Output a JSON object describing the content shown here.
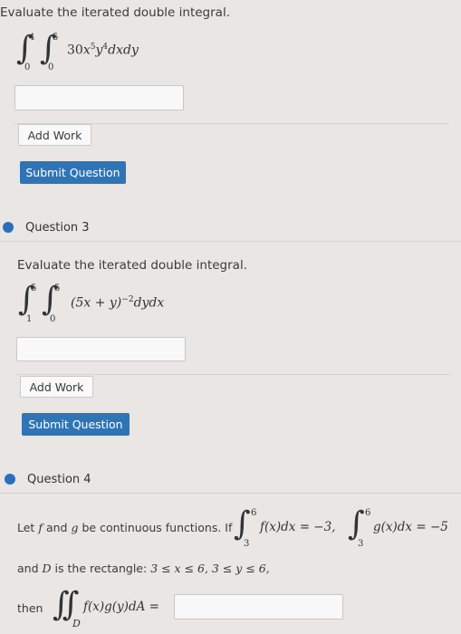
{
  "q2": {
    "prompt": "Evaluate the iterated double integral.",
    "outer": {
      "lower": "0",
      "upper": "4"
    },
    "inner": {
      "lower": "0",
      "upper": "5"
    },
    "integrand_coef": "30",
    "integrand_x": "x",
    "integrand_x_exp": "5",
    "integrand_y": "y",
    "integrand_y_exp": "4",
    "differentials": "dxdy",
    "add_work": "Add Work",
    "submit": "Submit Question"
  },
  "q3": {
    "heading": "Question 3",
    "prompt": "Evaluate the iterated double integral.",
    "outer": {
      "lower": "1",
      "upper": "5"
    },
    "inner": {
      "lower": "0",
      "upper": "5"
    },
    "integrand": "(5x + y)",
    "exponent": "−2",
    "differentials": "dydx",
    "add_work": "Add Work",
    "submit": "Submit Question"
  },
  "q4": {
    "heading": "Question 4",
    "let_text": "Let",
    "f": "f",
    "and": "and",
    "g": "g",
    "be_text": "be continuous functions. If",
    "int1_lower": "3",
    "int1_upper": "6",
    "int1_body": "f(x)dx = −3,",
    "int2_lower": "3",
    "int2_upper": "6",
    "int2_body": "g(x)dx = −5",
    "and_text": "and",
    "D": "D",
    "rect_text": "is the rectangle:",
    "rect_cond": "3 ≤ x ≤ 6, 3 ≤ y ≤ 6,",
    "then": "then",
    "D_sub": "D",
    "then_body": "f(x)g(y)dA ="
  },
  "colors": {
    "accent": "#2f75b6",
    "bullet": "#2b6fbc",
    "background": "#e9e6e3"
  }
}
